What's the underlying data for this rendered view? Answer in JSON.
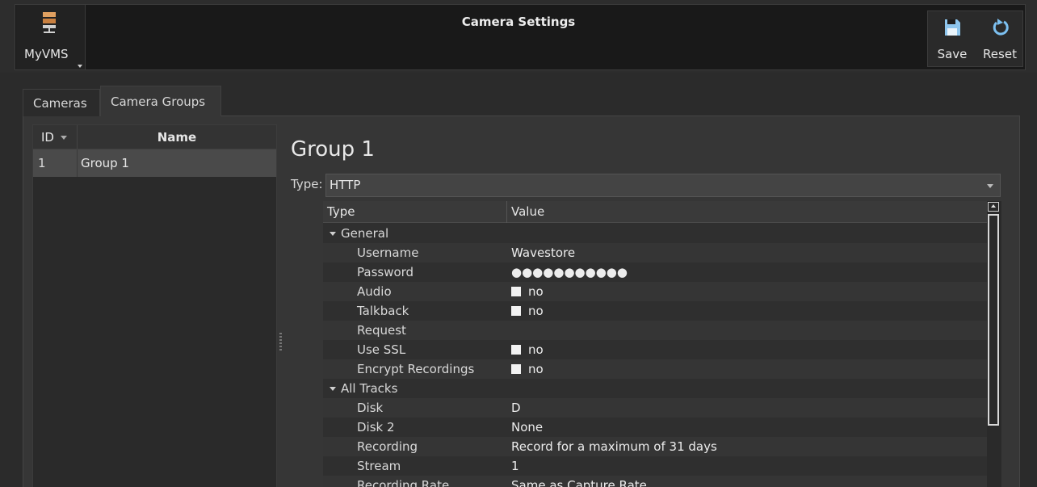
{
  "app": {
    "name": "MyVMS",
    "window_title": "Camera Settings"
  },
  "toolbar": {
    "save_label": "Save",
    "reset_label": "Reset"
  },
  "tabs": [
    {
      "label": "Cameras",
      "active": false
    },
    {
      "label": "Camera Groups",
      "active": true
    }
  ],
  "group_list": {
    "columns": {
      "id": "ID",
      "name": "Name"
    },
    "rows": [
      {
        "id": "1",
        "name": "Group 1",
        "selected": true
      }
    ]
  },
  "detail": {
    "title": "Group 1",
    "type_label": "Type:",
    "type_value": "HTTP",
    "columns": {
      "type": "Type",
      "value": "Value"
    },
    "rows": [
      {
        "kind": "section",
        "name": "General"
      },
      {
        "kind": "prop",
        "name": "Username",
        "value": "Wavestore"
      },
      {
        "kind": "prop",
        "name": "Password",
        "value": "●●●●●●●●●●●"
      },
      {
        "kind": "check",
        "name": "Audio",
        "value": "no"
      },
      {
        "kind": "check",
        "name": "Talkback",
        "value": "no"
      },
      {
        "kind": "prop",
        "name": "Request",
        "value": ""
      },
      {
        "kind": "check",
        "name": "Use SSL",
        "value": "no"
      },
      {
        "kind": "check",
        "name": "Encrypt Recordings",
        "value": "no"
      },
      {
        "kind": "section",
        "name": "All Tracks"
      },
      {
        "kind": "prop",
        "name": "Disk",
        "value": "D"
      },
      {
        "kind": "prop",
        "name": "Disk 2",
        "value": "None"
      },
      {
        "kind": "prop",
        "name": "Recording",
        "value": "Record for a maximum of 31 days"
      },
      {
        "kind": "prop",
        "name": "Stream",
        "value": "1"
      },
      {
        "kind": "prop",
        "name": "Recording Rate",
        "value": "Same as Capture Rate"
      }
    ]
  }
}
